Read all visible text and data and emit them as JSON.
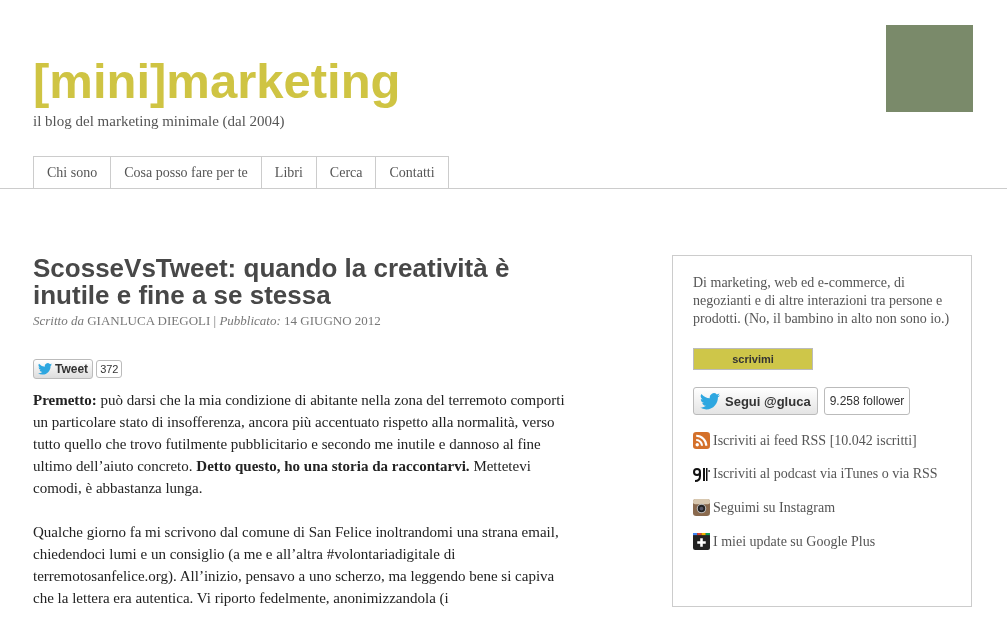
{
  "header": {
    "logo": "[mini]marketing",
    "tagline": "il blog del marketing minimale (dal 2004)"
  },
  "nav": [
    "Chi sono",
    "Cosa posso fare per te",
    "Libri",
    "Cerca",
    "Contatti"
  ],
  "post": {
    "title": "ScosseVsTweet: quando la creatività è inutile e fine a se stessa",
    "byline": "*Scritto da* GIANLUCA DIEGOLI | *Pubblicato:* 14 GIUGNO 2012",
    "tweet_button": {
      "label": "Tweet",
      "count": "372"
    },
    "paragraphs": [
      "**Premetto:** può darsi che la mia condizione di abitante nella zona del terremoto comporti un particolare stato di insofferenza, ancora più accentuato rispetto alla normalità, verso tutto quello che trovo futilmente pubblicitario e secondo me inutile e dannoso al fine ultimo dell’aiuto concreto. **Detto questo, ho una storia da raccontarvi.** Mettetevi comodi, è abbastanza lunga.",
      "Qualche giorno fa mi scrivono dal comune di San Felice inoltrandomi una strana email, chiedendoci lumi e un consiglio (a me e all’altra #volontariadigitale di terremotosanfelice.org). All’inizio, pensavo a uno scherzo, ma leggendo bene si capiva che la lettera era autentica. Vi riporto fedelmente, anonimizzandola (i"
    ]
  },
  "sidebar": {
    "about": "Di marketing, web ed e-commerce, di negozianti e di altre interazioni tra persone e prodotti. (No, il bambino in alto non sono io.)",
    "contact_button": "scrivimi",
    "follow": {
      "label": "Segui @gluca",
      "count": "9.258 follower"
    },
    "links": [
      {
        "kind": "rss",
        "label": "Iscriviti ai feed RSS [10.042 iscritti]"
      },
      {
        "kind": "podcast",
        "label": "Iscriviti al podcast via iTunes o via RSS"
      },
      {
        "kind": "instagram",
        "label": "Seguimi su Instagram"
      },
      {
        "kind": "googleplus",
        "label": "I miei update su Google Plus"
      }
    ]
  }
}
